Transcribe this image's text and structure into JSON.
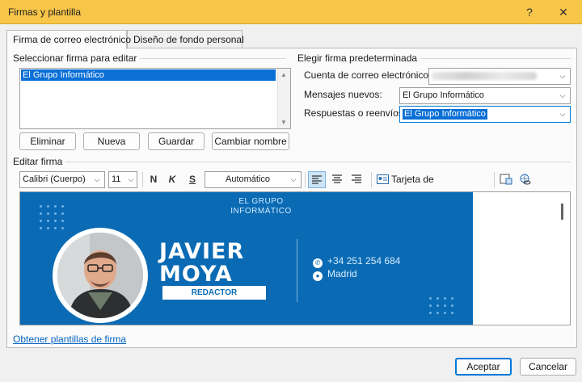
{
  "window": {
    "title": "Firmas y plantilla",
    "help_label": "?",
    "close_label": "✕"
  },
  "tabs": [
    {
      "label": "Firma de correo electrónico"
    },
    {
      "label": "Diseño de fondo personal"
    }
  ],
  "select_sig": {
    "group_label": "Seleccionar firma para editar",
    "items": [
      "El Grupo Informático"
    ],
    "buttons": {
      "delete": "Eliminar",
      "new": "Nueva",
      "save": "Guardar",
      "rename": "Cambiar nombre"
    }
  },
  "default_sig": {
    "group_label": "Elegir firma predeterminada",
    "account_label": "Cuenta de correo electrónico:",
    "new_messages_label": "Mensajes nuevos:",
    "new_messages_value": "El Grupo Informático",
    "replies_label": "Respuestas o reenvíos:",
    "replies_value": "El Grupo Informático"
  },
  "edit": {
    "label": "Editar firma",
    "font": "Calibri (Cuerpo)",
    "size": "11",
    "bold": "N",
    "italic": "K",
    "underline": "S",
    "color": "Automático",
    "business_card": "Tarjeta de presentación"
  },
  "signature": {
    "brand_line1": "EL GRUPO",
    "brand_line2": "INFORMÁTICO",
    "first_name": "JAVIER",
    "last_name": "MOYA",
    "role": "REDACTOR",
    "phone": "+34 251 254 684",
    "city": "Madrid",
    "bg_color": "#0a6bb4"
  },
  "footer": {
    "templates_link": "Obtener plantillas de firma",
    "ok": "Aceptar",
    "cancel": "Cancelar"
  },
  "colors": {
    "titlebar": "#f7c548",
    "accent": "#0078d7",
    "selection": "#0a6fd6"
  }
}
